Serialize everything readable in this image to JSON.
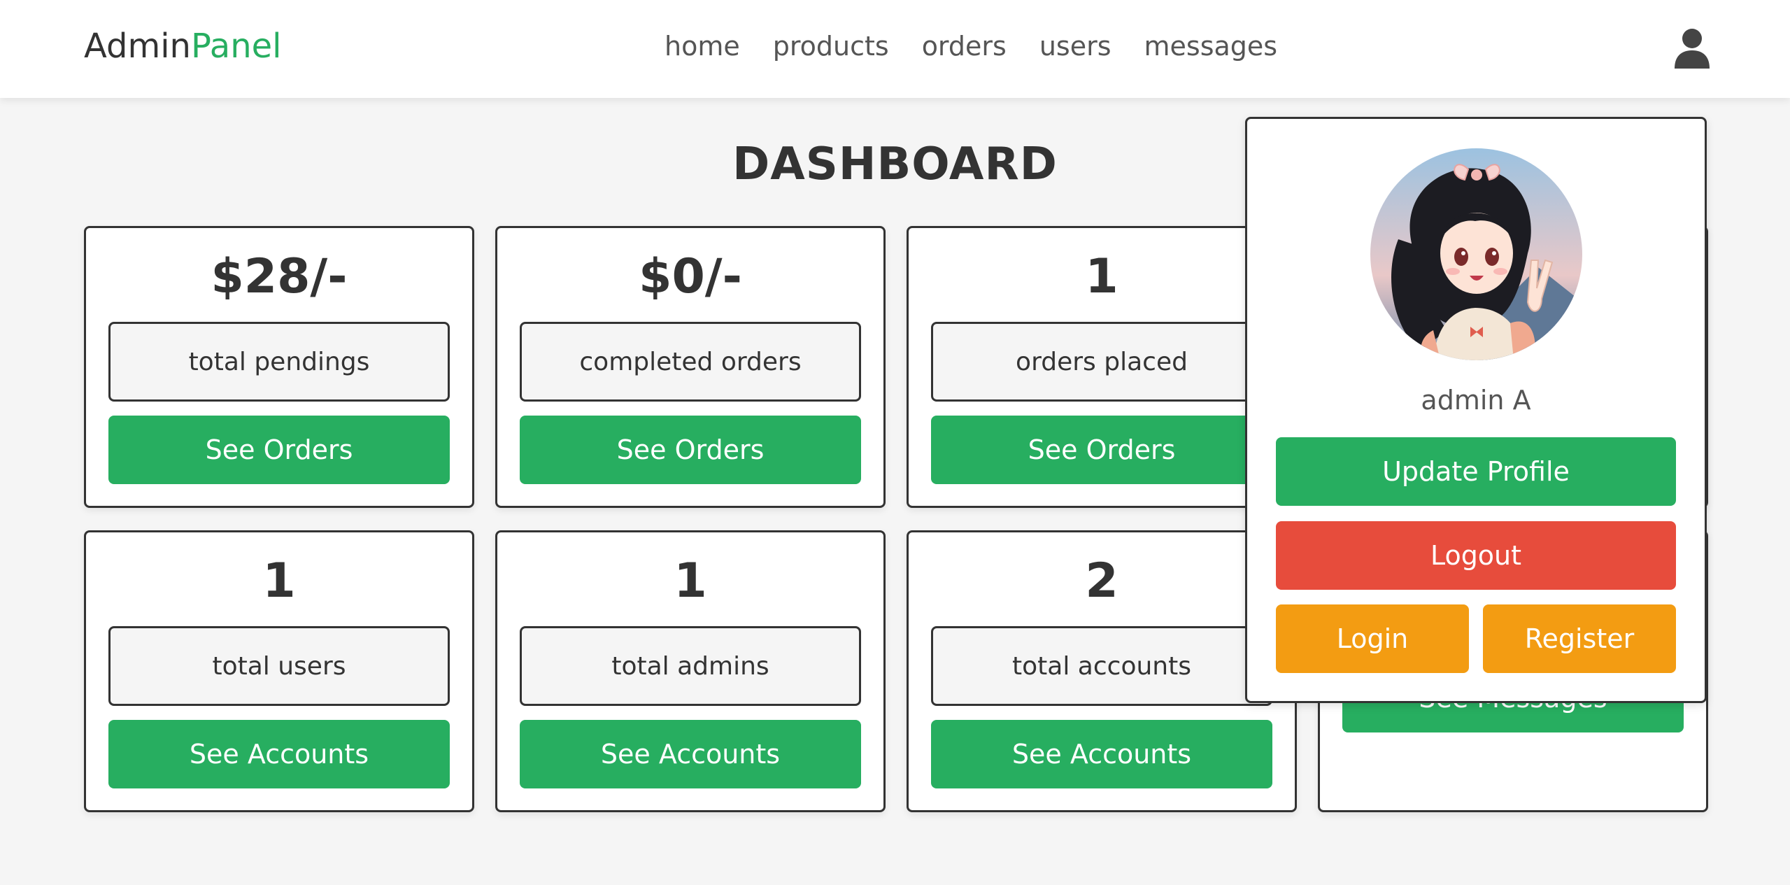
{
  "header": {
    "logo_main": "Admin",
    "logo_accent": "Panel",
    "nav": [
      "home",
      "products",
      "orders",
      "users",
      "messages"
    ],
    "user_icon": "user-icon"
  },
  "title": "DASHBOARD",
  "boxes": [
    {
      "value": "$28/-",
      "label": "total pendings",
      "button": "See Orders"
    },
    {
      "value": "$0/-",
      "label": "completed orders",
      "button": "See Orders"
    },
    {
      "value": "1",
      "label": "orders placed",
      "button": "See Orders"
    },
    {
      "value": "",
      "label": "",
      "button": ""
    },
    {
      "value": "1",
      "label": "total users",
      "button": "See Accounts"
    },
    {
      "value": "1",
      "label": "total admins",
      "button": "See Accounts"
    },
    {
      "value": "2",
      "label": "total accounts",
      "button": "See Accounts"
    },
    {
      "value": "",
      "label": "",
      "button": "See Messages"
    }
  ],
  "profile": {
    "name": "admin A",
    "update_label": "Update Profile",
    "logout_label": "Logout",
    "login_label": "Login",
    "register_label": "Register"
  },
  "colors": {
    "accent": "#27ae60",
    "danger": "#e74c3c",
    "warning": "#f39c12",
    "text": "#333333",
    "background": "#f5f5f5"
  }
}
